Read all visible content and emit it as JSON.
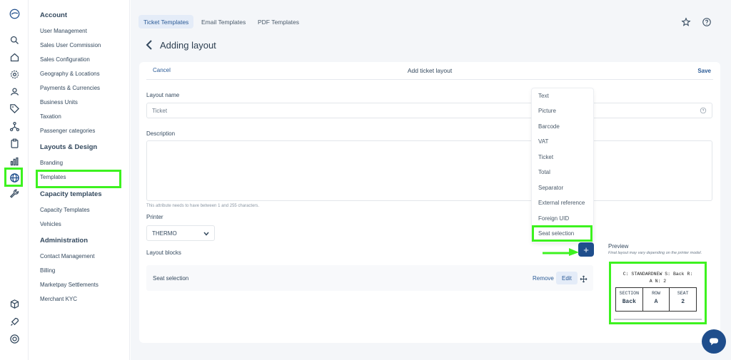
{
  "rail": {
    "icons": [
      "logo-icon",
      "search-icon",
      "home-icon",
      "gear-icon",
      "user-badge-icon",
      "tag-icon",
      "network-icon",
      "clipboard-icon",
      "bar-chart-icon",
      "globe-icon",
      "wrench-icon",
      "cube-icon",
      "rocket-icon",
      "lifebuoy-icon"
    ]
  },
  "sidebar": {
    "account": {
      "title": "Account",
      "items": [
        "User Management",
        "Sales User Commission",
        "Sales Configuration",
        "Geography & Locations",
        "Payments & Currencies",
        "Business Units",
        "Taxation",
        "Passenger categories"
      ]
    },
    "layouts": {
      "title": "Layouts & Design",
      "items": [
        "Branding",
        "Templates"
      ]
    },
    "capacity": {
      "title": "Capacity templates",
      "items": [
        "Capacity Templates",
        "Vehicles"
      ]
    },
    "admin": {
      "title": "Administration",
      "items": [
        "Contact Management",
        "Billing",
        "Marketpay Settlements",
        "Merchant KYC"
      ]
    }
  },
  "tabs": [
    "Ticket Templates",
    "Email Templates",
    "PDF Templates"
  ],
  "page_title": "Adding layout",
  "form": {
    "cancel": "Cancel",
    "header": "Add ticket layout",
    "save": "Save",
    "layout_name_label": "Layout name",
    "layout_name_value": "Ticket",
    "description_label": "Description",
    "description_hint": "This attribute needs to have between 1 and 255 characters.",
    "printer_label": "Printer",
    "printer_value": "THERMO",
    "layout_blocks_label": "Layout blocks",
    "block_name": "Seat selection",
    "remove": "Remove",
    "edit": "Edit",
    "add_symbol": "+"
  },
  "dropdown": [
    "Text",
    "Picture",
    "Barcode",
    "VAT",
    "Ticket",
    "Total",
    "Separator",
    "External reference",
    "Foreign UID",
    "Seat selection"
  ],
  "preview": {
    "title": "Preview",
    "note": "Final layout may vary depending on the printer model.",
    "line1": "C: STANDARDNEW S: Back R:",
    "line2": "A N: 2",
    "headers": [
      "SECTION",
      "ROW",
      "SEAT"
    ],
    "values": [
      "Back",
      "A",
      "2"
    ]
  },
  "colors": {
    "highlight": "#3df21f",
    "primary": "#1f4e8c",
    "accent": "#2a5a96"
  }
}
